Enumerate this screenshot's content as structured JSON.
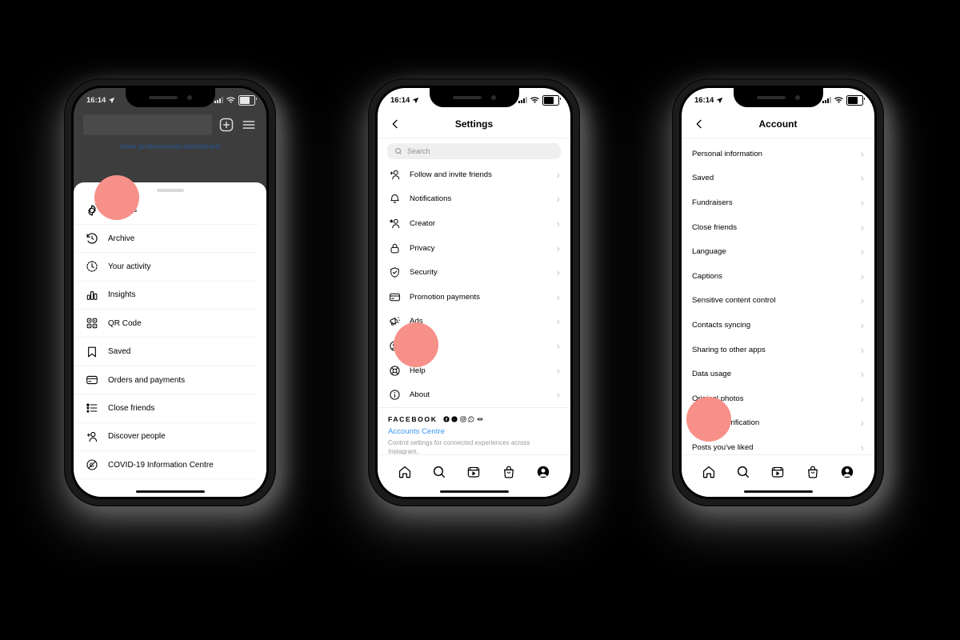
{
  "meta": {
    "background_color": "#000000",
    "highlight_color": "#f79089",
    "accent_link_color": "#3897f0"
  },
  "status_bar": {
    "time": "16:14",
    "location_icon": "location-arrow-icon",
    "signal_icon": "cellular-signal-icon",
    "wifi_icon": "wifi-icon",
    "battery_icon": "battery-icon"
  },
  "phone1": {
    "name": "instagram-profile-menu-sheet",
    "header": {
      "username_placeholder": "",
      "add_icon": "plus-square-icon",
      "menu_icon": "hamburger-menu-icon",
      "professional_dashboard_label": "View professional dashboard"
    },
    "menu_items": [
      {
        "label": "Settings",
        "icon": "gear-icon",
        "highlighted": true
      },
      {
        "label": "Archive",
        "icon": "archive-clock-icon",
        "highlighted": false
      },
      {
        "label": "Your activity",
        "icon": "activity-clock-icon",
        "highlighted": false
      },
      {
        "label": "Insights",
        "icon": "insights-bar-chart-icon",
        "highlighted": false
      },
      {
        "label": "QR Code",
        "icon": "qr-code-icon",
        "highlighted": false
      },
      {
        "label": "Saved",
        "icon": "bookmark-icon",
        "highlighted": false
      },
      {
        "label": "Orders and payments",
        "icon": "credit-card-icon",
        "highlighted": false
      },
      {
        "label": "Close friends",
        "icon": "close-friends-list-icon",
        "highlighted": false
      },
      {
        "label": "Discover people",
        "icon": "add-person-icon",
        "highlighted": false
      },
      {
        "label": "COVID-19 Information Centre",
        "icon": "covid-info-icon",
        "highlighted": false
      }
    ]
  },
  "phone2": {
    "name": "settings-screen",
    "nav": {
      "back_icon": "chevron-left-icon",
      "title": "Settings"
    },
    "search": {
      "placeholder": "Search",
      "icon": "search-icon"
    },
    "items": [
      {
        "label": "Follow and invite friends",
        "icon": "add-person-icon",
        "highlighted": false
      },
      {
        "label": "Notifications",
        "icon": "bell-icon",
        "highlighted": false
      },
      {
        "label": "Creator",
        "icon": "star-person-icon",
        "highlighted": false
      },
      {
        "label": "Privacy",
        "icon": "lock-icon",
        "highlighted": false
      },
      {
        "label": "Security",
        "icon": "shield-check-icon",
        "highlighted": false
      },
      {
        "label": "Promotion payments",
        "icon": "credit-card-icon",
        "highlighted": false
      },
      {
        "label": "Ads",
        "icon": "megaphone-icon",
        "highlighted": false
      },
      {
        "label": "Account",
        "icon": "account-circle-icon",
        "highlighted": true
      },
      {
        "label": "Help",
        "icon": "lifebuoy-icon",
        "highlighted": false
      },
      {
        "label": "About",
        "icon": "info-circle-icon",
        "highlighted": false
      }
    ],
    "facebook_section": {
      "brand": "FACEBOOK",
      "brand_icons": [
        "facebook-icon",
        "messenger-icon",
        "instagram-icon",
        "whatsapp-icon",
        "portal-icon"
      ],
      "link": "Accounts Centre",
      "description": "Control settings for connected experiences across Instagram,"
    }
  },
  "phone3": {
    "name": "account-settings-screen",
    "nav": {
      "back_icon": "chevron-left-icon",
      "title": "Account"
    },
    "items": [
      {
        "label": "Personal information",
        "highlighted": false
      },
      {
        "label": "Saved",
        "highlighted": false
      },
      {
        "label": "Fundraisers",
        "highlighted": false
      },
      {
        "label": "Close friends",
        "highlighted": false
      },
      {
        "label": "Language",
        "highlighted": false
      },
      {
        "label": "Captions",
        "highlighted": false
      },
      {
        "label": "Sensitive content control",
        "highlighted": false
      },
      {
        "label": "Contacts syncing",
        "highlighted": false
      },
      {
        "label": "Sharing to other apps",
        "highlighted": false
      },
      {
        "label": "Data usage",
        "highlighted": false
      },
      {
        "label": "Original photos",
        "highlighted": false
      },
      {
        "label": "Request verification",
        "highlighted": true
      },
      {
        "label": "Posts you've liked",
        "highlighted": false
      }
    ]
  },
  "tab_bar": {
    "items": [
      {
        "icon": "home-icon",
        "active": false
      },
      {
        "icon": "search-icon",
        "active": false
      },
      {
        "icon": "reels-icon",
        "active": false
      },
      {
        "icon": "shop-bag-icon",
        "active": false
      },
      {
        "icon": "profile-icon",
        "active": true
      }
    ]
  },
  "chevron_glyph": "›"
}
